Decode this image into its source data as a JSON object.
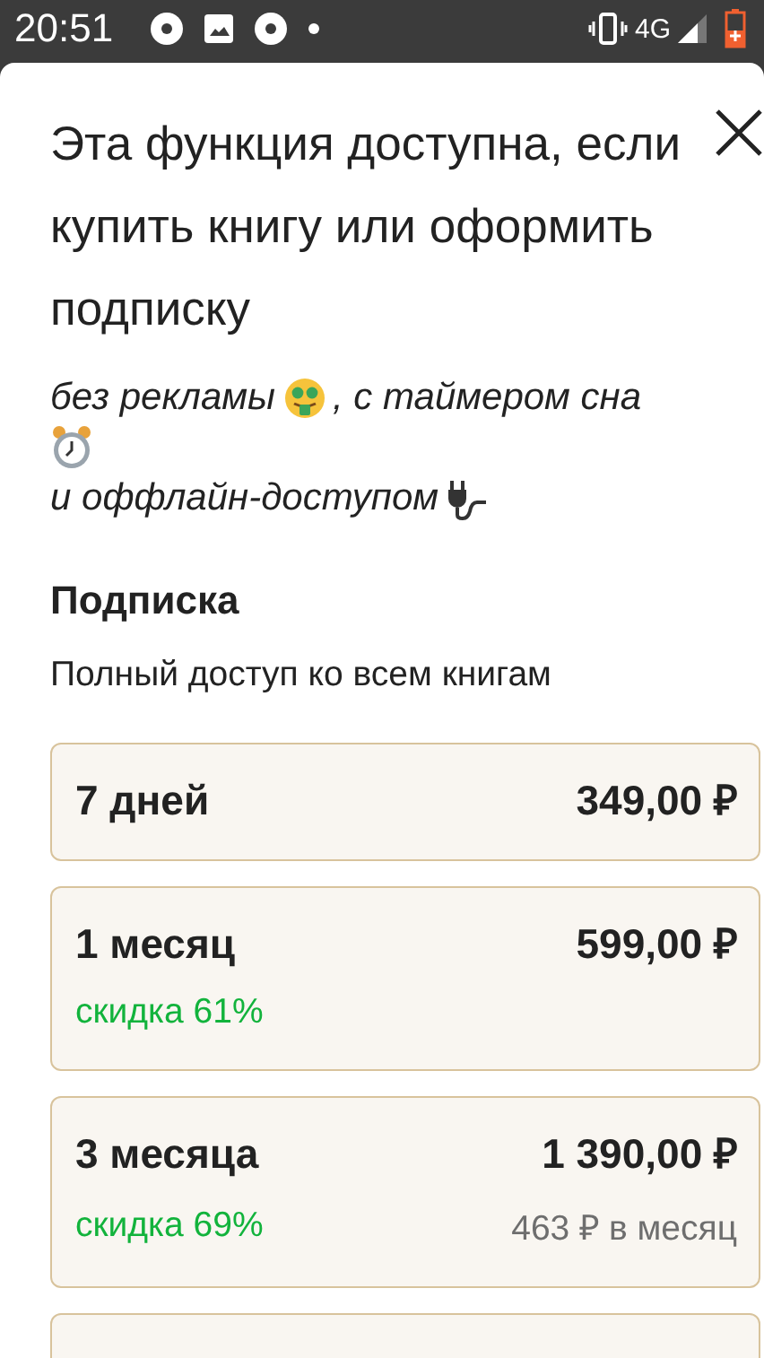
{
  "status_bar": {
    "time": "20:51",
    "network": "4G"
  },
  "dialog": {
    "title": "Эта функция доступна, если купить книгу или оформить подписку",
    "features": [
      "без рекламы",
      ", с таймером сна",
      "и оффлайн-доступом"
    ],
    "section_title": "Подписка",
    "section_subtitle": "Полный доступ ко всем книгам",
    "plans": [
      {
        "name": "7 дней",
        "price": "349,00 ₽"
      },
      {
        "name": "1 месяц",
        "price": "599,00 ₽",
        "discount": "скидка 61%"
      },
      {
        "name": "3 месяца",
        "price": "1 390,00 ₽",
        "discount": "скидка 69%",
        "per_month": "463 ₽ в месяц"
      }
    ]
  }
}
